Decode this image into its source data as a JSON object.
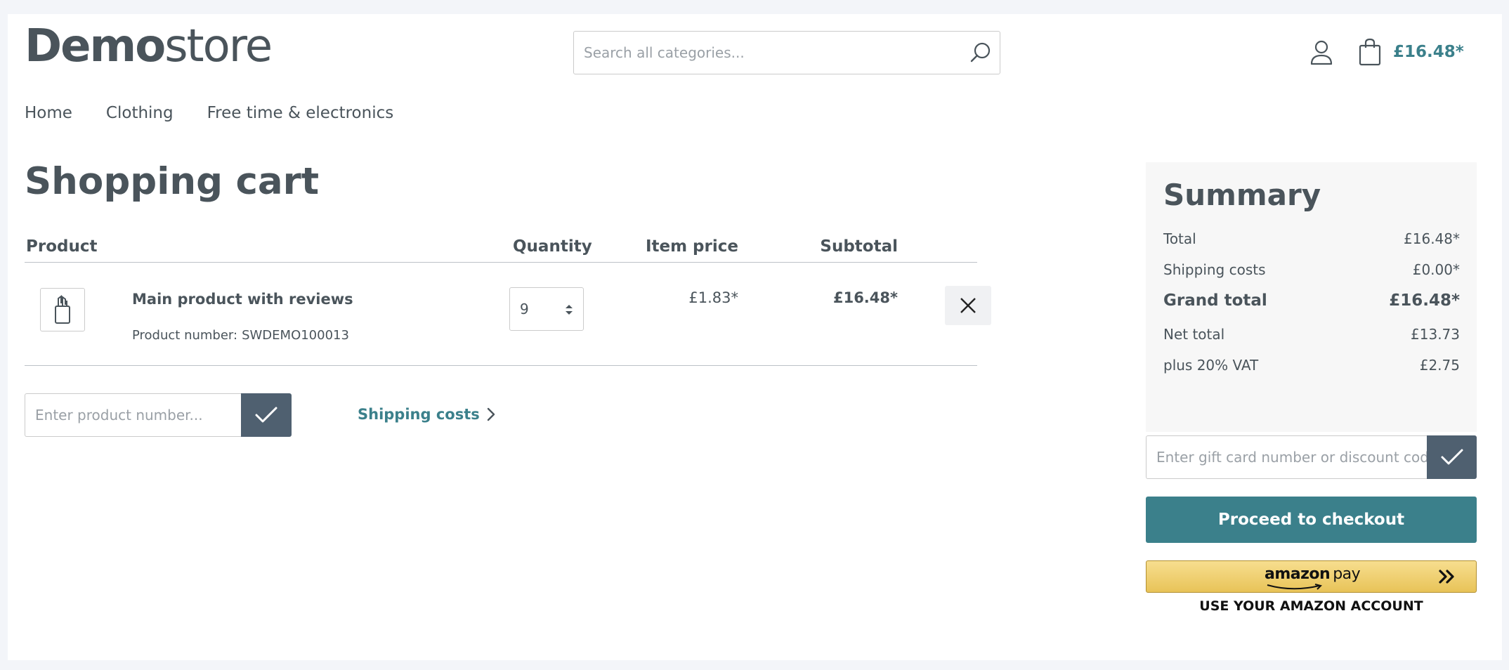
{
  "header": {
    "logo_bold": "Demo",
    "logo_light": "store",
    "search_placeholder": "Search all categories...",
    "cart_total": "£16.48*"
  },
  "nav": {
    "items": [
      "Home",
      "Clothing",
      "Free time & electronics"
    ]
  },
  "cart": {
    "title": "Shopping cart",
    "columns": {
      "product": "Product",
      "quantity": "Quantity",
      "item_price": "Item price",
      "subtotal": "Subtotal"
    },
    "line_items": [
      {
        "name": "Main product with reviews",
        "number_label": "Product number:",
        "number": "SWDEMO100013",
        "quantity": "9",
        "item_price": "£1.83*",
        "subtotal": "£16.48*"
      }
    ],
    "add_product_placeholder": "Enter product number...",
    "shipping_link": "Shipping costs"
  },
  "summary": {
    "title": "Summary",
    "rows": [
      {
        "label": "Total",
        "value": "£16.48*"
      },
      {
        "label": "Shipping costs",
        "value": "£0.00*"
      },
      {
        "label": "Grand total",
        "value": "£16.48*"
      },
      {
        "label": "Net total",
        "value": "£13.73"
      },
      {
        "label": "plus 20% VAT",
        "value": "£2.75"
      }
    ],
    "discount_placeholder": "Enter gift card number or discount code...",
    "checkout_label": "Proceed to checkout",
    "amazon_logo": "amazon",
    "amazon_pay": "pay",
    "amazon_caption": "USE YOUR AMAZON ACCOUNT"
  },
  "colors": {
    "accent": "#3b808b",
    "button_dark": "#4f6070",
    "text": "#4a545b",
    "amazon_gold": "#f0cf6f"
  }
}
